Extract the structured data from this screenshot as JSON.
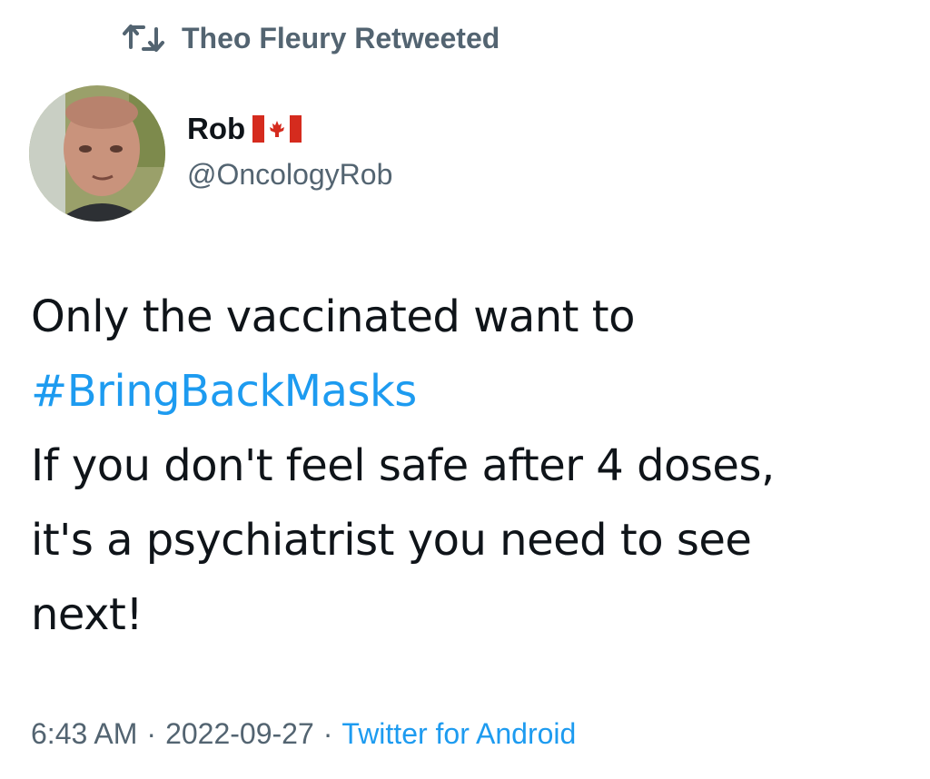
{
  "retweet": {
    "icon": "retweet-icon",
    "text": "Theo Fleury Retweeted"
  },
  "author": {
    "avatar_icon": "avatar",
    "display_name": "Rob",
    "flag_icon": "canada-flag-icon",
    "handle": "@OncologyRob"
  },
  "tweet": {
    "line1": "Only the vaccinated want to",
    "hashtag": "#BringBackMasks",
    "line3": "If you don't feel safe after 4 doses,",
    "line4": "it's a psychiatrist you need to see",
    "line5": "next!"
  },
  "meta": {
    "time": "6:43 AM",
    "separator": "·",
    "date": "2022-09-27",
    "source": "Twitter for Android"
  },
  "colors": {
    "text": "#0f1419",
    "secondary": "#536471",
    "link": "#1d9bf0",
    "flag_red": "#d52b1e"
  }
}
